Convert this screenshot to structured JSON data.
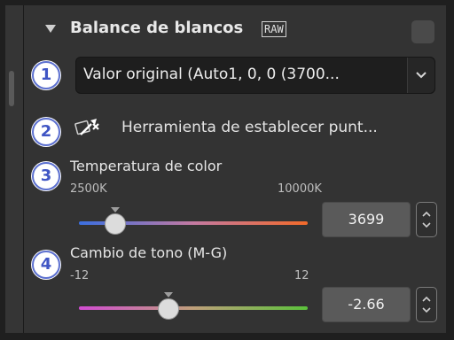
{
  "panel": {
    "title": "Balance de blancos",
    "raw_badge": "RAW"
  },
  "white_balance": {
    "dropdown_value": "Valor original (Auto1, 0, 0 (3700..."
  },
  "tool": {
    "label": "Herramienta de establecer punt..."
  },
  "temperature": {
    "title": "Temperatura de color",
    "min_label": "2500K",
    "max_label": "10000K",
    "value": "3699",
    "slider_fraction": 0.16
  },
  "tint": {
    "title": "Cambio de tono (M-G)",
    "min_label": "-12",
    "max_label": "12",
    "value": "-2.66",
    "slider_fraction": 0.39
  },
  "callouts": [
    "1",
    "2",
    "3",
    "4"
  ],
  "colors": {
    "callout_border": "#5b6fcf",
    "callout_text": "#3f55c4",
    "temp_gradient_start": "#3b6fe0",
    "temp_gradient_end": "#f26a2a",
    "tint_gradient_start": "#d24cd2",
    "tint_gradient_end": "#5bc23b"
  }
}
